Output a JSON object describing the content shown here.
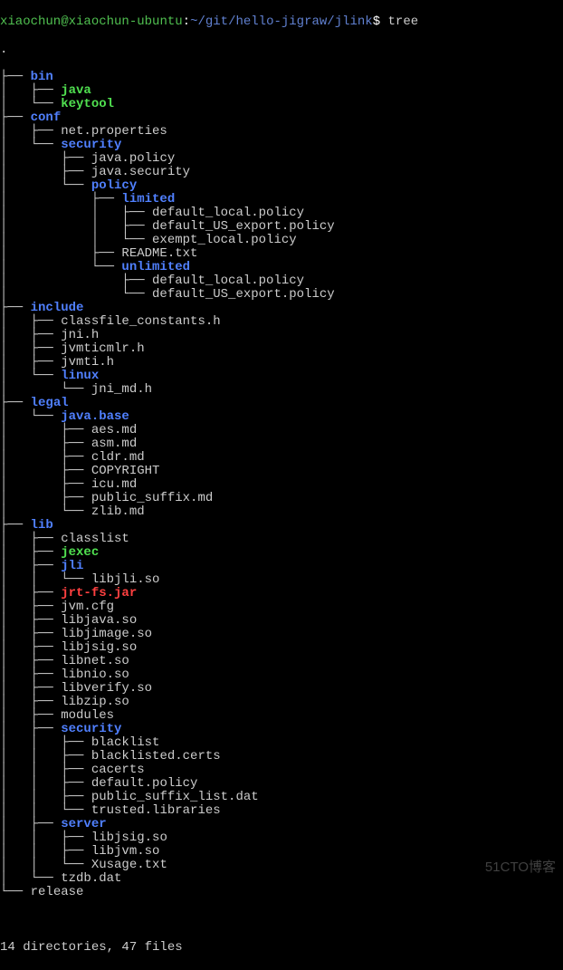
{
  "prompt": {
    "user": "xiaochun",
    "at": "@",
    "host": "xiaochun-ubuntu",
    "colon": ":",
    "path": "~/git/hello-jigraw/jlink",
    "dollar": "$",
    "command": " tree"
  },
  "tree": {
    "root": ".",
    "lines": [
      {
        "prefix": "├── ",
        "name": "bin",
        "type": "dir"
      },
      {
        "prefix": "│   ├── ",
        "name": "java",
        "type": "exec"
      },
      {
        "prefix": "│   └── ",
        "name": "keytool",
        "type": "exec"
      },
      {
        "prefix": "├── ",
        "name": "conf",
        "type": "dir"
      },
      {
        "prefix": "│   ├── ",
        "name": "net.properties",
        "type": "file"
      },
      {
        "prefix": "│   └── ",
        "name": "security",
        "type": "dir"
      },
      {
        "prefix": "│       ├── ",
        "name": "java.policy",
        "type": "file"
      },
      {
        "prefix": "│       ├── ",
        "name": "java.security",
        "type": "file"
      },
      {
        "prefix": "│       └── ",
        "name": "policy",
        "type": "dir"
      },
      {
        "prefix": "│           ├── ",
        "name": "limited",
        "type": "dir"
      },
      {
        "prefix": "│           │   ├── ",
        "name": "default_local.policy",
        "type": "file"
      },
      {
        "prefix": "│           │   ├── ",
        "name": "default_US_export.policy",
        "type": "file"
      },
      {
        "prefix": "│           │   └── ",
        "name": "exempt_local.policy",
        "type": "file"
      },
      {
        "prefix": "│           ├── ",
        "name": "README.txt",
        "type": "file"
      },
      {
        "prefix": "│           └── ",
        "name": "unlimited",
        "type": "dir"
      },
      {
        "prefix": "│               ├── ",
        "name": "default_local.policy",
        "type": "file"
      },
      {
        "prefix": "│               └── ",
        "name": "default_US_export.policy",
        "type": "file"
      },
      {
        "prefix": "├── ",
        "name": "include",
        "type": "dir"
      },
      {
        "prefix": "│   ├── ",
        "name": "classfile_constants.h",
        "type": "file"
      },
      {
        "prefix": "│   ├── ",
        "name": "jni.h",
        "type": "file"
      },
      {
        "prefix": "│   ├── ",
        "name": "jvmticmlr.h",
        "type": "file"
      },
      {
        "prefix": "│   ├── ",
        "name": "jvmti.h",
        "type": "file"
      },
      {
        "prefix": "│   └── ",
        "name": "linux",
        "type": "dir"
      },
      {
        "prefix": "│       └── ",
        "name": "jni_md.h",
        "type": "file"
      },
      {
        "prefix": "├── ",
        "name": "legal",
        "type": "dir"
      },
      {
        "prefix": "│   └── ",
        "name": "java.base",
        "type": "dir"
      },
      {
        "prefix": "│       ├── ",
        "name": "aes.md",
        "type": "file"
      },
      {
        "prefix": "│       ├── ",
        "name": "asm.md",
        "type": "file"
      },
      {
        "prefix": "│       ├── ",
        "name": "cldr.md",
        "type": "file"
      },
      {
        "prefix": "│       ├── ",
        "name": "COPYRIGHT",
        "type": "file"
      },
      {
        "prefix": "│       ├── ",
        "name": "icu.md",
        "type": "file"
      },
      {
        "prefix": "│       ├── ",
        "name": "public_suffix.md",
        "type": "file"
      },
      {
        "prefix": "│       └── ",
        "name": "zlib.md",
        "type": "file"
      },
      {
        "prefix": "├── ",
        "name": "lib",
        "type": "dir"
      },
      {
        "prefix": "│   ├── ",
        "name": "classlist",
        "type": "file"
      },
      {
        "prefix": "│   ├── ",
        "name": "jexec",
        "type": "exec"
      },
      {
        "prefix": "│   ├── ",
        "name": "jli",
        "type": "dir"
      },
      {
        "prefix": "│   │   └── ",
        "name": "libjli.so",
        "type": "file"
      },
      {
        "prefix": "│   ├── ",
        "name": "jrt-fs.jar",
        "type": "archive"
      },
      {
        "prefix": "│   ├── ",
        "name": "jvm.cfg",
        "type": "file"
      },
      {
        "prefix": "│   ├── ",
        "name": "libjava.so",
        "type": "file"
      },
      {
        "prefix": "│   ├── ",
        "name": "libjimage.so",
        "type": "file"
      },
      {
        "prefix": "│   ├── ",
        "name": "libjsig.so",
        "type": "file"
      },
      {
        "prefix": "│   ├── ",
        "name": "libnet.so",
        "type": "file"
      },
      {
        "prefix": "│   ├── ",
        "name": "libnio.so",
        "type": "file"
      },
      {
        "prefix": "│   ├── ",
        "name": "libverify.so",
        "type": "file"
      },
      {
        "prefix": "│   ├── ",
        "name": "libzip.so",
        "type": "file"
      },
      {
        "prefix": "│   ├── ",
        "name": "modules",
        "type": "file"
      },
      {
        "prefix": "│   ├── ",
        "name": "security",
        "type": "dir"
      },
      {
        "prefix": "│   │   ├── ",
        "name": "blacklist",
        "type": "file"
      },
      {
        "prefix": "│   │   ├── ",
        "name": "blacklisted.certs",
        "type": "file"
      },
      {
        "prefix": "│   │   ├── ",
        "name": "cacerts",
        "type": "file"
      },
      {
        "prefix": "│   │   ├── ",
        "name": "default.policy",
        "type": "file"
      },
      {
        "prefix": "│   │   ├── ",
        "name": "public_suffix_list.dat",
        "type": "file"
      },
      {
        "prefix": "│   │   └── ",
        "name": "trusted.libraries",
        "type": "file"
      },
      {
        "prefix": "│   ├── ",
        "name": "server",
        "type": "dir"
      },
      {
        "prefix": "│   │   ├── ",
        "name": "libjsig.so",
        "type": "file"
      },
      {
        "prefix": "│   │   ├── ",
        "name": "libjvm.so",
        "type": "file"
      },
      {
        "prefix": "│   │   └── ",
        "name": "Xusage.txt",
        "type": "file"
      },
      {
        "prefix": "│   └── ",
        "name": "tzdb.dat",
        "type": "file"
      },
      {
        "prefix": "└── ",
        "name": "release",
        "type": "file"
      }
    ]
  },
  "summary": "14 directories, 47 files",
  "watermark": "51CTO博客"
}
